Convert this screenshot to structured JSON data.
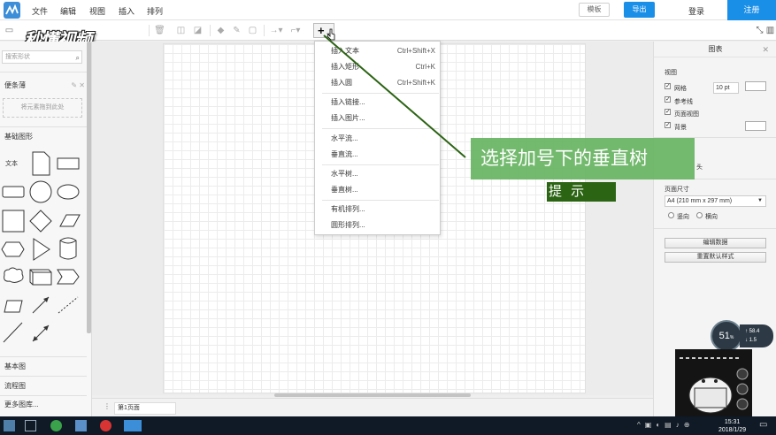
{
  "app": {
    "menu": [
      "文件",
      "编辑",
      "视图",
      "插入",
      "排列"
    ],
    "buttons": {
      "template": "模板",
      "export": "导出",
      "login": "登录",
      "register": "注册"
    },
    "brand_color": "#1a8fe8"
  },
  "watermark": "秒懂视频",
  "toolbar": {
    "insert_button": "+"
  },
  "sidebar": {
    "search_placeholder": "搜索形状",
    "sections": {
      "sticky": "便条薄",
      "drop_hint": "将元素拖到此处",
      "basic": "基础图形",
      "basic2": "基本图",
      "flowchart": "流程图",
      "more": "更多图库..."
    },
    "text_shape_label": "文本"
  },
  "dropdown": {
    "items": [
      {
        "label": "插入文本",
        "shortcut": "Ctrl+Shift+X"
      },
      {
        "label": "插入矩形",
        "shortcut": "Ctrl+K"
      },
      {
        "label": "插入圆",
        "shortcut": "Ctrl+Shift+K"
      },
      {
        "label": "插入链接...",
        "shortcut": ""
      },
      {
        "label": "插入图片...",
        "shortcut": ""
      },
      {
        "label": "水平流...",
        "shortcut": ""
      },
      {
        "label": "垂直流...",
        "shortcut": ""
      },
      {
        "label": "水平树...",
        "shortcut": ""
      },
      {
        "label": "垂直树...",
        "shortcut": ""
      },
      {
        "label": "有机排列...",
        "shortcut": ""
      },
      {
        "label": "圆形排列...",
        "shortcut": ""
      }
    ]
  },
  "hint": {
    "banner": "选择加号下的垂直树",
    "tag": "提 示",
    "color": "#2b6413"
  },
  "right_panel": {
    "title": "图表",
    "view_section": "视图",
    "grid": "网格",
    "grid_size": "10 pt",
    "guides": "参考线",
    "page_view": "页面视图",
    "background": "背景",
    "paper_size_label": "页面尺寸",
    "paper_size": "A4 (210 mm x 297 mm)",
    "portrait": "竖向",
    "landscape": "横向",
    "edit_data": "编辑数据",
    "reset_style": "重置默认样式",
    "partial": "头"
  },
  "pagebar": {
    "page1": "第1页面"
  },
  "widgets": {
    "speed_percent": "51",
    "speed_up": "58.4",
    "speed_down": "1.5",
    "clock_time": "15:31",
    "clock_date": "2018/1/29"
  }
}
